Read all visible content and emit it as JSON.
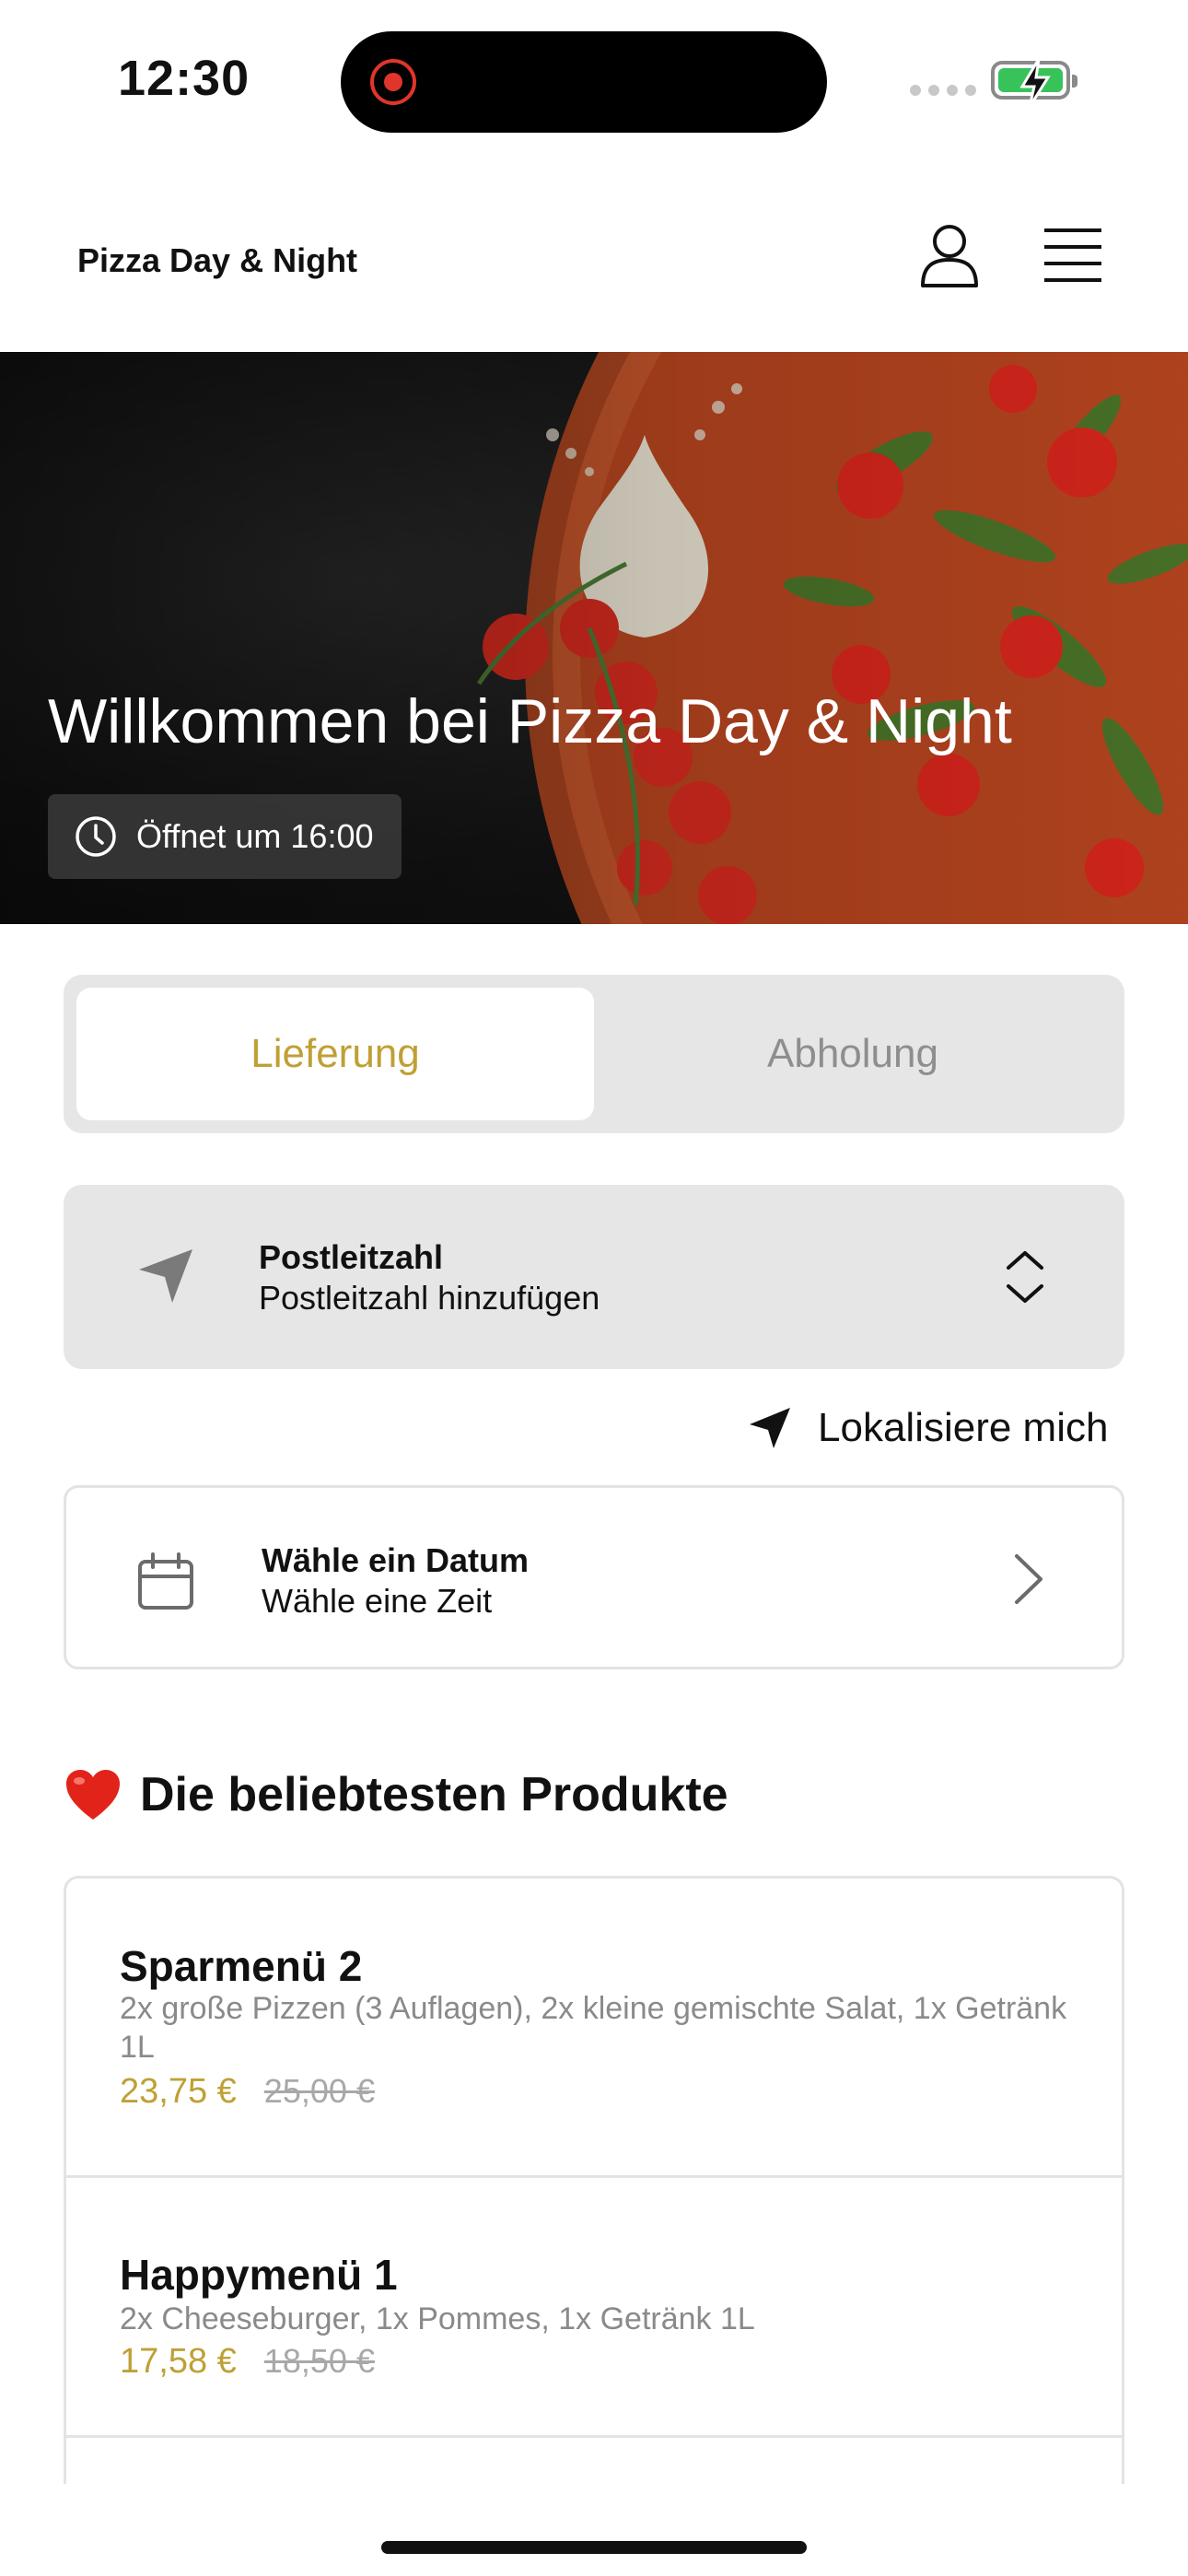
{
  "status_bar": {
    "time": "12:30",
    "icons": [
      "recording-icon",
      "signal-dots-icon",
      "battery-charging-icon"
    ],
    "colors": {
      "recording": "#e0352b",
      "battery": "#38c35a"
    }
  },
  "header": {
    "brand": "Pizza Day & Night",
    "icons": [
      "profile-icon",
      "menu-icon"
    ]
  },
  "hero": {
    "title": "Willkommen bei Pizza Day & Night",
    "opening_text": "Öffnet um 16:00",
    "icon": "clock-icon"
  },
  "mode_tabs": {
    "items": [
      {
        "label": "Lieferung",
        "active": true
      },
      {
        "label": "Abholung",
        "active": false
      }
    ],
    "accent_color": "#bfa035"
  },
  "postcode": {
    "label": "Postleitzahl",
    "value": "Postleitzahl hinzufügen",
    "icons": [
      "navigation-arrow-icon",
      "chevron-updown-icon"
    ]
  },
  "locate": {
    "label": "Lokalisiere mich",
    "icon": "location-arrow-icon"
  },
  "date_picker": {
    "label": "Wähle ein Datum",
    "value": "Wähle eine Zeit",
    "icons": [
      "calendar-icon",
      "chevron-right-icon"
    ]
  },
  "popular": {
    "title": "Die beliebtesten Produkte",
    "icon": "heart-icon",
    "products": [
      {
        "name": "Sparmenü 2",
        "description": "2x große Pizzen (3 Auflagen), 2x kleine gemischte Salat, 1x Getränk 1L",
        "price": "23,75 €",
        "old_price": "25,00 €"
      },
      {
        "name": "Happymenü 1",
        "description": "2x Cheeseburger, 1x Pommes, 1x Getränk 1L",
        "price": "17,58 €",
        "old_price": "18,50 €"
      }
    ]
  }
}
